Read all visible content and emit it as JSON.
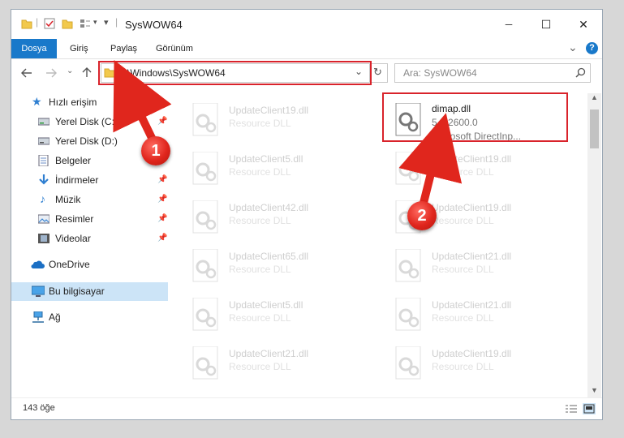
{
  "window": {
    "title": "SysWOW64",
    "minimize_glyph": "─",
    "maximize_glyph": "☐",
    "close_glyph": "✕"
  },
  "ribbon": {
    "tabs": [
      {
        "label": "Dosya",
        "active": true
      },
      {
        "label": "Giriş",
        "active": false
      },
      {
        "label": "Paylaş",
        "active": false
      },
      {
        "label": "Görünüm",
        "active": false
      }
    ],
    "expand_glyph": "⌄",
    "help_glyph": "?"
  },
  "address": {
    "path": "C:\\Windows\\SysWOW64",
    "search_placeholder": "Ara: SysWOW64"
  },
  "sidebar": {
    "items": [
      {
        "label": "Hızlı erişim",
        "icon": "star-icon",
        "pinned": false
      },
      {
        "label": "Yerel Disk (C:)",
        "icon": "drive-icon",
        "pinned": true
      },
      {
        "label": "Yerel Disk (D:)",
        "icon": "drive-icon",
        "pinned": false
      },
      {
        "label": "Belgeler",
        "icon": "document-icon",
        "pinned": false
      },
      {
        "label": "İndirmeler",
        "icon": "download-icon",
        "pinned": true
      },
      {
        "label": "Müzik",
        "icon": "music-icon",
        "pinned": true
      },
      {
        "label": "Resimler",
        "icon": "pictures-icon",
        "pinned": true
      },
      {
        "label": "Videolar",
        "icon": "video-icon",
        "pinned": true
      },
      {
        "label": "OneDrive",
        "icon": "cloud-icon",
        "pinned": false
      },
      {
        "label": "Bu bilgisayar",
        "icon": "computer-icon",
        "pinned": false,
        "selected": true
      },
      {
        "label": "Ağ",
        "icon": "network-icon",
        "pinned": false
      }
    ]
  },
  "files": {
    "left_column": [
      {
        "name": "UpdateClient19.dll",
        "type": "Resource DLL"
      },
      {
        "name": "UpdateClient5.dll",
        "type": "Resource DLL"
      },
      {
        "name": "UpdateClient42.dll",
        "type": "Resource DLL"
      },
      {
        "name": "UpdateClient65.dll",
        "type": "Resource DLL"
      },
      {
        "name": "UpdateClient5.dll",
        "type": "Resource DLL"
      },
      {
        "name": "UpdateClient21.dll",
        "type": "Resource DLL"
      }
    ],
    "highlighted": {
      "name": "dimap.dll",
      "version": "5.1.2600.0",
      "description": "Microsoft DirectInp..."
    },
    "right_column": [
      {
        "name": "UpdateClient19.dll",
        "type": "Resource DLL"
      },
      {
        "name": "UpdateClient19.dll",
        "type": "Resource DLL"
      },
      {
        "name": "UpdateClient21.dll",
        "type": "Resource DLL"
      },
      {
        "name": "UpdateClient21.dll",
        "type": "Resource DLL"
      },
      {
        "name": "UpdateClient19.dll",
        "type": "Resource DLL"
      }
    ]
  },
  "status": {
    "count": "143 öğe"
  },
  "annotations": {
    "step1": "1",
    "step2": "2",
    "color": "#d9232b"
  }
}
